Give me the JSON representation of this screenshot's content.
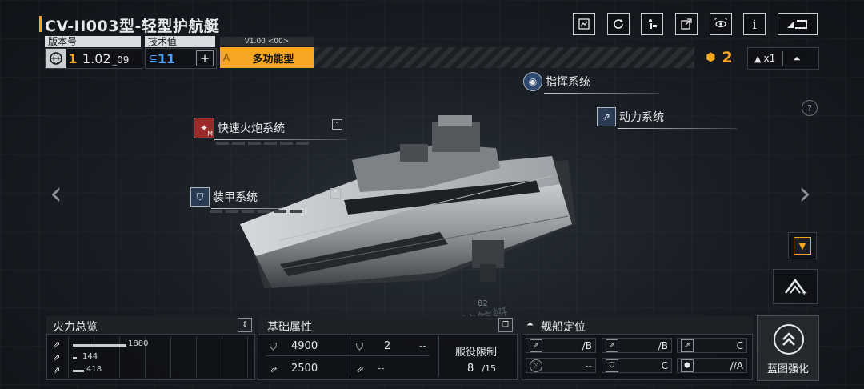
{
  "header": {
    "title": "CV-II003型-轻型护航艇",
    "version_label": "版本号",
    "version_level": "1",
    "version_value": "1.02",
    "version_sub": "09",
    "tech_label": "技术值",
    "tech_value": "11",
    "build_version": "V1.00 <00>",
    "grade": "A",
    "role": "多功能型",
    "cost": "2",
    "multiplier": "x1",
    "icons": [
      "blueprint-icon",
      "refresh-icon",
      "paint-icon",
      "share-icon",
      "view-icon",
      "info-icon",
      "back-icon"
    ],
    "info_glyph": "i"
  },
  "callouts": {
    "command": "指挥系统",
    "power": "动力系统",
    "cannon": "快速火炮系统",
    "cannon_badge": "M",
    "armor": "装甲系统"
  },
  "hull_text": {
    "number": "82",
    "name": "护航艇"
  },
  "firepower": {
    "title": "火力总览",
    "values": [
      "1880",
      "144",
      "418"
    ],
    "fractions": [
      0.8,
      0.06,
      0.17
    ]
  },
  "attributes": {
    "title": "基础属性",
    "hp": "4900",
    "armor_count": "2",
    "armor_sub": "--",
    "speed": "2500",
    "evasion": "--",
    "limit_label": "服役限制",
    "limit_current": "8",
    "limit_max": "/15"
  },
  "positioning": {
    "title": "舰船定位",
    "grades": [
      "/B",
      "/B",
      "C",
      "--",
      "C",
      "//A"
    ]
  },
  "action": {
    "label": "蓝图强化"
  },
  "nav": {
    "prev": "‹",
    "next": "›",
    "help": "?"
  },
  "colors": {
    "accent": "#f5a623",
    "panel_border": "#3a4047",
    "callout_icon": "#2a3b55",
    "cannon_icon": "#9a2a2a"
  }
}
